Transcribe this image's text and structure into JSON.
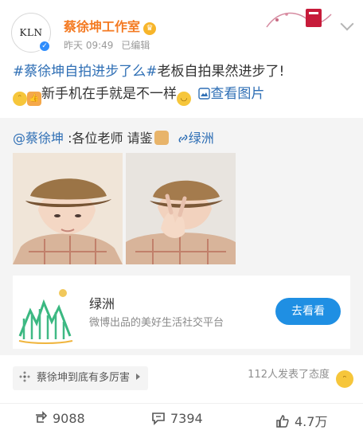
{
  "header": {
    "avatar_text": "KLN",
    "account_name": "蔡徐坤工作室",
    "post_time": "昨天 09:49",
    "edit_status": "已编辑"
  },
  "post": {
    "topic": "#蔡徐坤自拍进步了么#",
    "line1_rest": "老板自拍果然进步了!",
    "line2_text": "新手机在手就是不一样",
    "view_images": "查看图片"
  },
  "repost": {
    "mention": "@蔡徐坤",
    "text": ":各位老师 请鉴",
    "oasis_link": "绿洲"
  },
  "oasis_card": {
    "title": "绿洲",
    "subtitle": "微博出品的美好生活社交平台",
    "button": "去看看"
  },
  "hot_topic": "蔡徐坤到底有多厉害",
  "attitude_text": "112人发表了态度",
  "actions": {
    "repost_count": "9088",
    "comment_count": "7394",
    "like_count": "4.7万"
  },
  "colors": {
    "name_orange": "#f47a22",
    "link_blue": "#2f6fb5",
    "button_blue": "#1f8fe3"
  },
  "icons": [
    "verified-icon",
    "crown-icon",
    "chevron-down-icon",
    "image-icon",
    "link-icon",
    "repost-icon",
    "comment-icon",
    "like-icon"
  ]
}
